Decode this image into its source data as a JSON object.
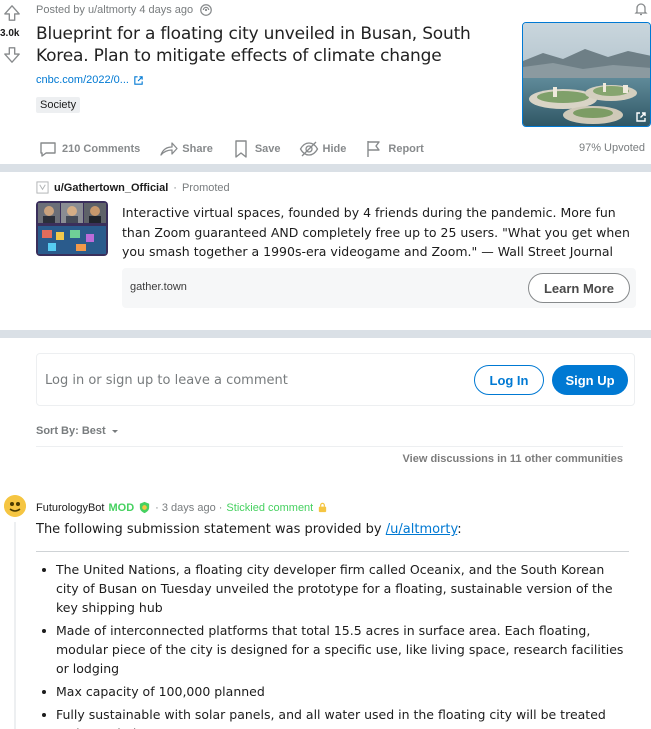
{
  "post": {
    "score": "3.0k",
    "posted_by": "Posted by u/altmorty 4 days ago",
    "title": "Blueprint for a floating city unveiled in Busan, South Korea. Plan to mitigate effects of climate change",
    "link": "cnbc.com/2022/0...",
    "flair": "Society",
    "actions": {
      "comments": "210 Comments",
      "share": "Share",
      "save": "Save",
      "hide": "Hide",
      "report": "Report"
    },
    "upvoted": "97% Upvoted"
  },
  "promoted": {
    "user": "u/Gathertown_Official",
    "separator": "·",
    "label": "Promoted",
    "text": "Interactive virtual spaces, founded by 4 friends during the pandemic. More fun than Zoom guaranteed AND completely free up to 25 users. \"What you get when you smash together a 1990s-era videogame and Zoom.\" — Wall Street Journal",
    "domain": "gather.town",
    "cta": "Learn More"
  },
  "login": {
    "prompt": "Log in or sign up to leave a comment",
    "login_label": "Log In",
    "signup_label": "Sign Up"
  },
  "sort": {
    "label": "Sort By: Best"
  },
  "view_discussions": "View discussions in 11 other communities",
  "comment": {
    "author": "FuturologyBot",
    "mod": "MOD",
    "time": "· 3 days ago ·",
    "stickied": "Stickied comment",
    "intro_prefix": "The following submission statement was provided by ",
    "intro_link": "/u/altmorty",
    "intro_suffix": ":",
    "bullets": [
      "The United Nations, a floating city developer firm called Oceanix, and the South Korean city of Busan on Tuesday unveiled the prototype for a floating, sustainable version of the key shipping hub",
      "Made of interconnected platforms that total 15.5 acres in surface area. Each floating, modular piece of the city is designed for a specific use, like living space, research facilities or lodging",
      "Max capacity of 100,000 planned",
      "Fully sustainable with solar panels, and all water used in the floating city will be treated and recycled"
    ]
  },
  "colors": {
    "accent": "#0079d3",
    "mod_green": "#46d160",
    "divider": "#dae0e6"
  }
}
